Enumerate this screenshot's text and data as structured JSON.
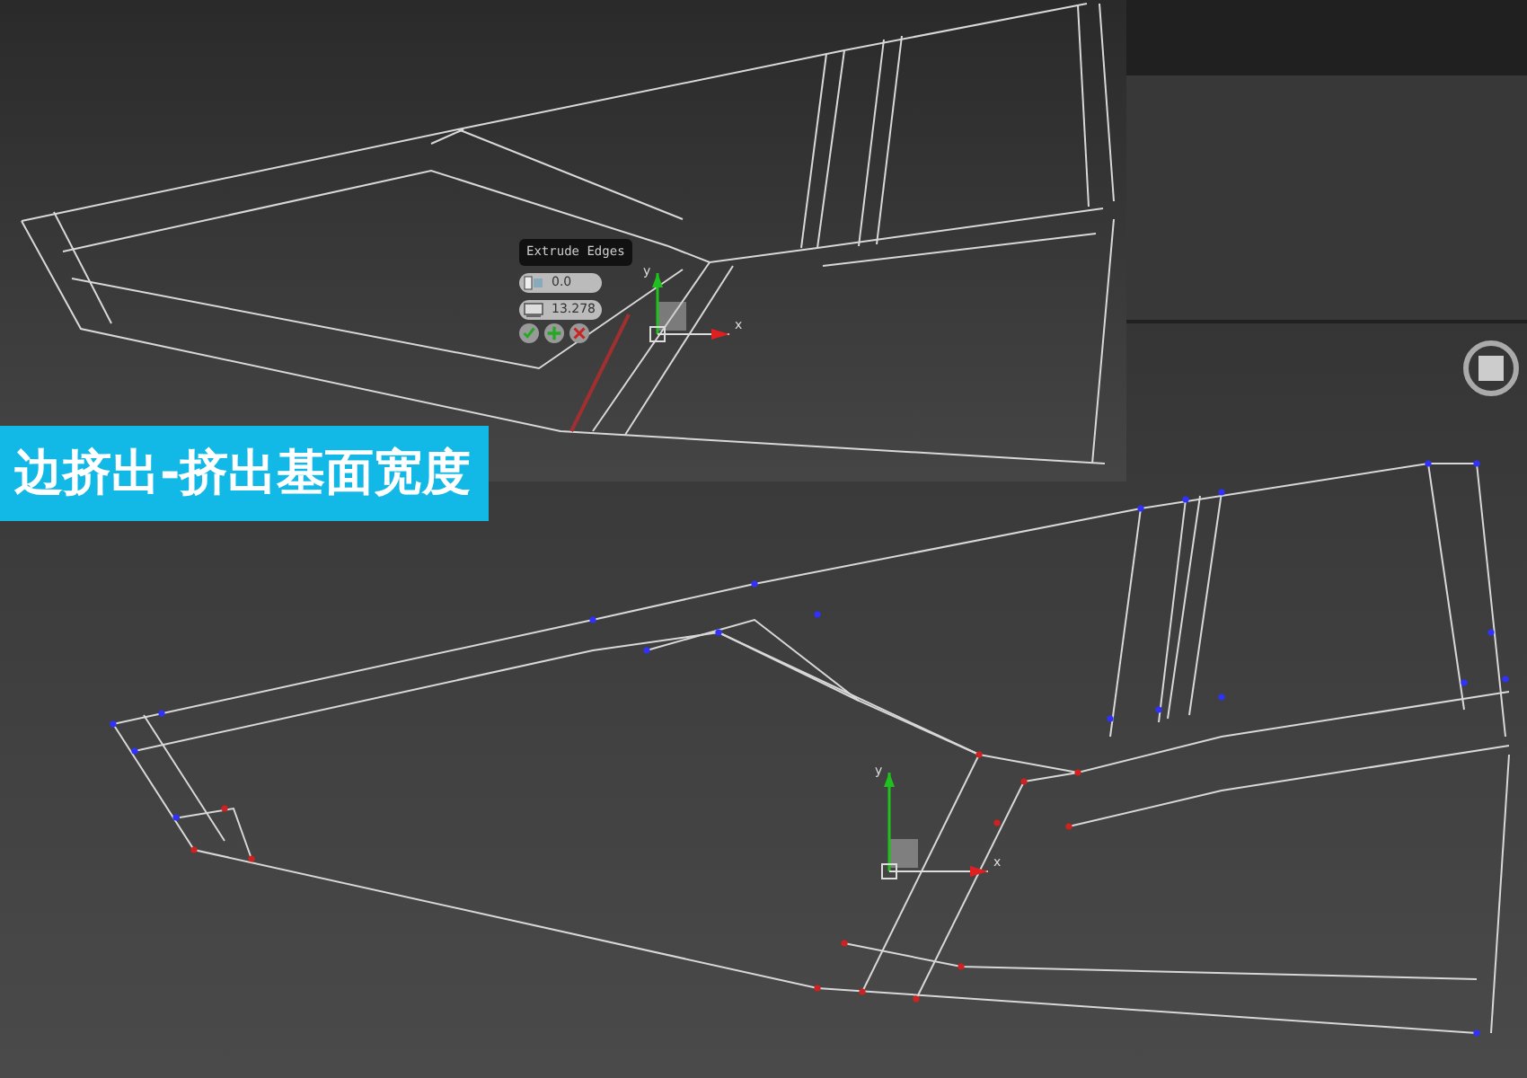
{
  "caption": {
    "text": "边挤出-挤出基面宽度"
  },
  "caddy": {
    "title": "Extrude Edges",
    "fields": [
      {
        "kind": "height",
        "value": "0.0"
      },
      {
        "kind": "width",
        "value": "13.278"
      }
    ],
    "buttons": [
      {
        "kind": "ok"
      },
      {
        "kind": "apply"
      },
      {
        "kind": "cancel"
      }
    ]
  },
  "gizmos": [
    {
      "y_label": "y",
      "x_label": "x"
    },
    {
      "y_label": "y",
      "x_label": "x"
    }
  ]
}
